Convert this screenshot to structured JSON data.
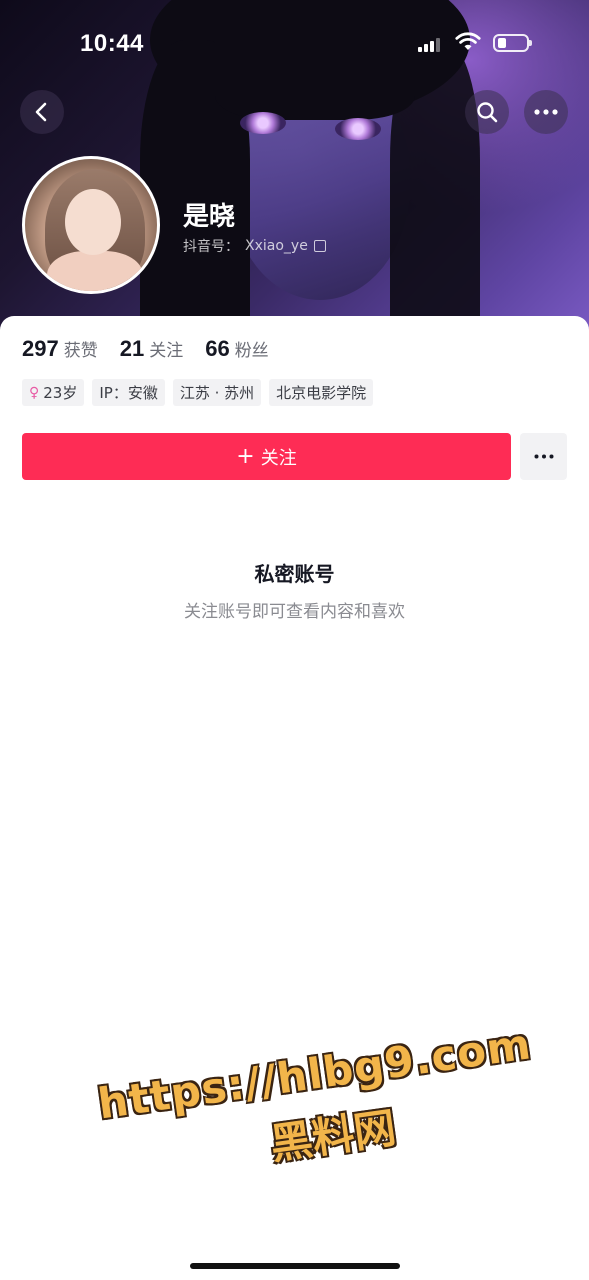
{
  "status_bar": {
    "time": "10:44"
  },
  "profile": {
    "name": "是晓",
    "douyin_id_label": "抖音号：",
    "douyin_id": "Xxiao_ye"
  },
  "stats": [
    {
      "value": "297",
      "label": "获赞"
    },
    {
      "value": "21",
      "label": "关注"
    },
    {
      "value": "66",
      "label": "粉丝"
    }
  ],
  "tags": {
    "gender_symbol": "♀",
    "age": "23岁",
    "ip": "IP：安徽",
    "location": "江苏 · 苏州",
    "school": "北京电影学院"
  },
  "actions": {
    "follow_label": "关注",
    "follow_icon": "+"
  },
  "private_notice": {
    "title": "私密账号",
    "subtitle": "关注账号即可查看内容和喜欢"
  },
  "watermark": {
    "line1": "https://hlbg9.com",
    "line2": "黑料网"
  },
  "colors": {
    "accent": "#fe2c55",
    "tag_bg": "#f2f2f4"
  }
}
